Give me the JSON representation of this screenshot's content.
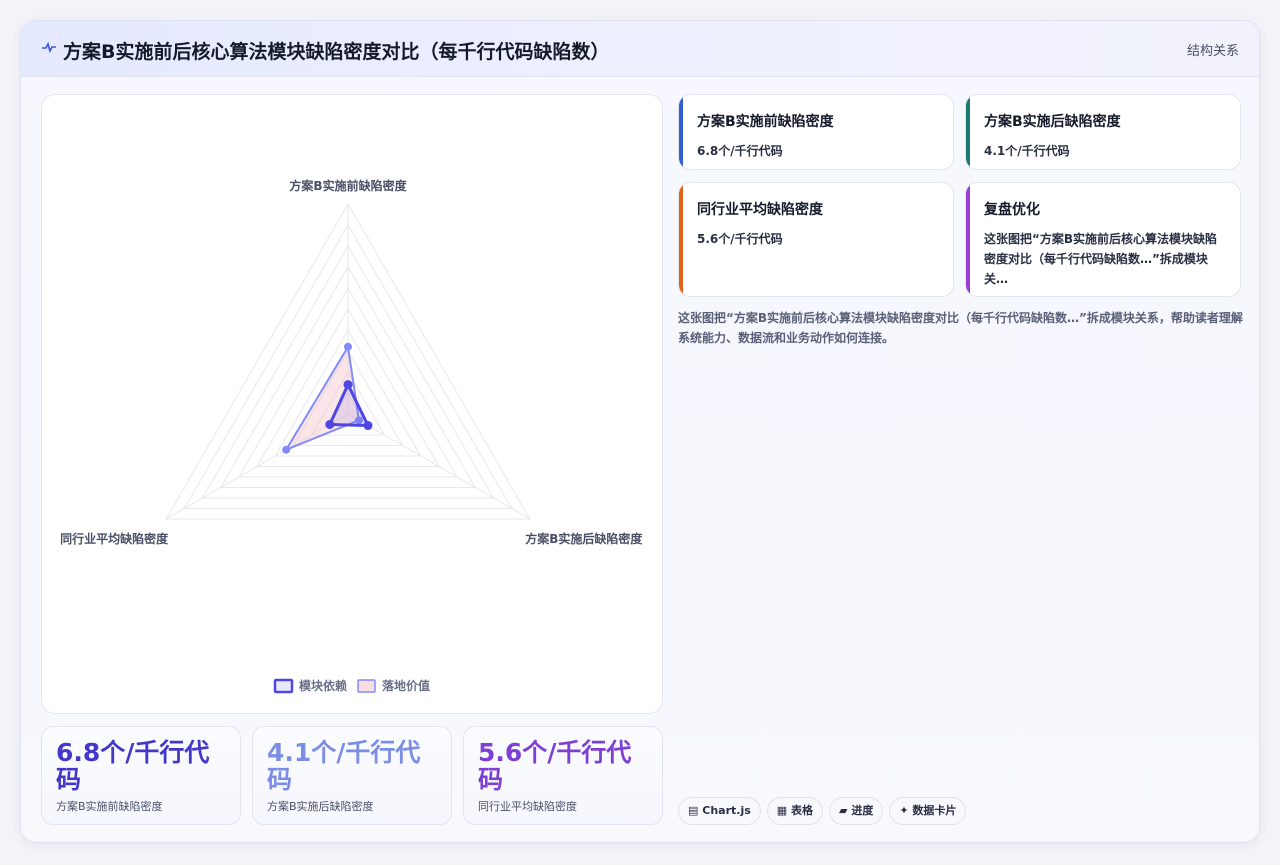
{
  "header": {
    "title": "方案B实施前后核心算法模块缺陷密度对比（每千行代码缺陷数）",
    "right_link": "结构关系",
    "logo_icon": "pulse-icon"
  },
  "chart_data": {
    "type": "radar",
    "axes": [
      "方案B实施前缺陷密度",
      "方案B实施后缺陷密度",
      "同行业平均缺陷密度"
    ],
    "series": [
      {
        "name": "模块依赖",
        "values": [
          1.4,
          1.1,
          1.0
        ],
        "color": "#4f46e5"
      },
      {
        "name": "落地价值",
        "values": [
          3.2,
          0.6,
          3.4
        ],
        "color": "#818cf8"
      }
    ],
    "rmax": 10,
    "rings": 10,
    "legend_position": "bottom"
  },
  "stats": [
    {
      "value": "6.8个/千行代码",
      "label": "方案B实施前缺陷密度",
      "color": "#4338ca"
    },
    {
      "value": "4.1个/千行代码",
      "label": "方案B实施后缺陷密度",
      "color": "#7c8de6"
    },
    {
      "value": "5.6个/千行代码",
      "label": "同行业平均缺陷密度",
      "color": "#7e3fd3"
    }
  ],
  "cards": [
    {
      "title": "方案B实施前缺陷密度",
      "value": "6.8个/千行代码",
      "accent": "#2f5fd0"
    },
    {
      "title": "方案B实施后缺陷密度",
      "value": "4.1个/千行代码",
      "accent": "#1a7a70"
    },
    {
      "title": "同行业平均缺陷密度",
      "value": "5.6个/千行代码",
      "accent": "#e06418"
    },
    {
      "title": "复盘优化",
      "value": "这张图把“方案B实施前后核心算法模块缺陷密度对比（每千行代码缺陷数…”拆成模块关…",
      "accent": "#9b3ed6"
    }
  ],
  "description": "这张图把“方案B实施前后核心算法模块缺陷密度对比（每千行代码缺陷数…”拆成模块关系，帮助读者理解系统能力、数据流和业务动作如何连接。",
  "chips": [
    {
      "icon": "chart-icon",
      "glyph": "▤",
      "label": "Chart.js"
    },
    {
      "icon": "table-icon",
      "glyph": "▦",
      "label": "表格"
    },
    {
      "icon": "progress-icon",
      "glyph": "▰",
      "label": "进度"
    },
    {
      "icon": "sparkle-icon",
      "glyph": "✦",
      "label": "数据卡片"
    }
  ]
}
